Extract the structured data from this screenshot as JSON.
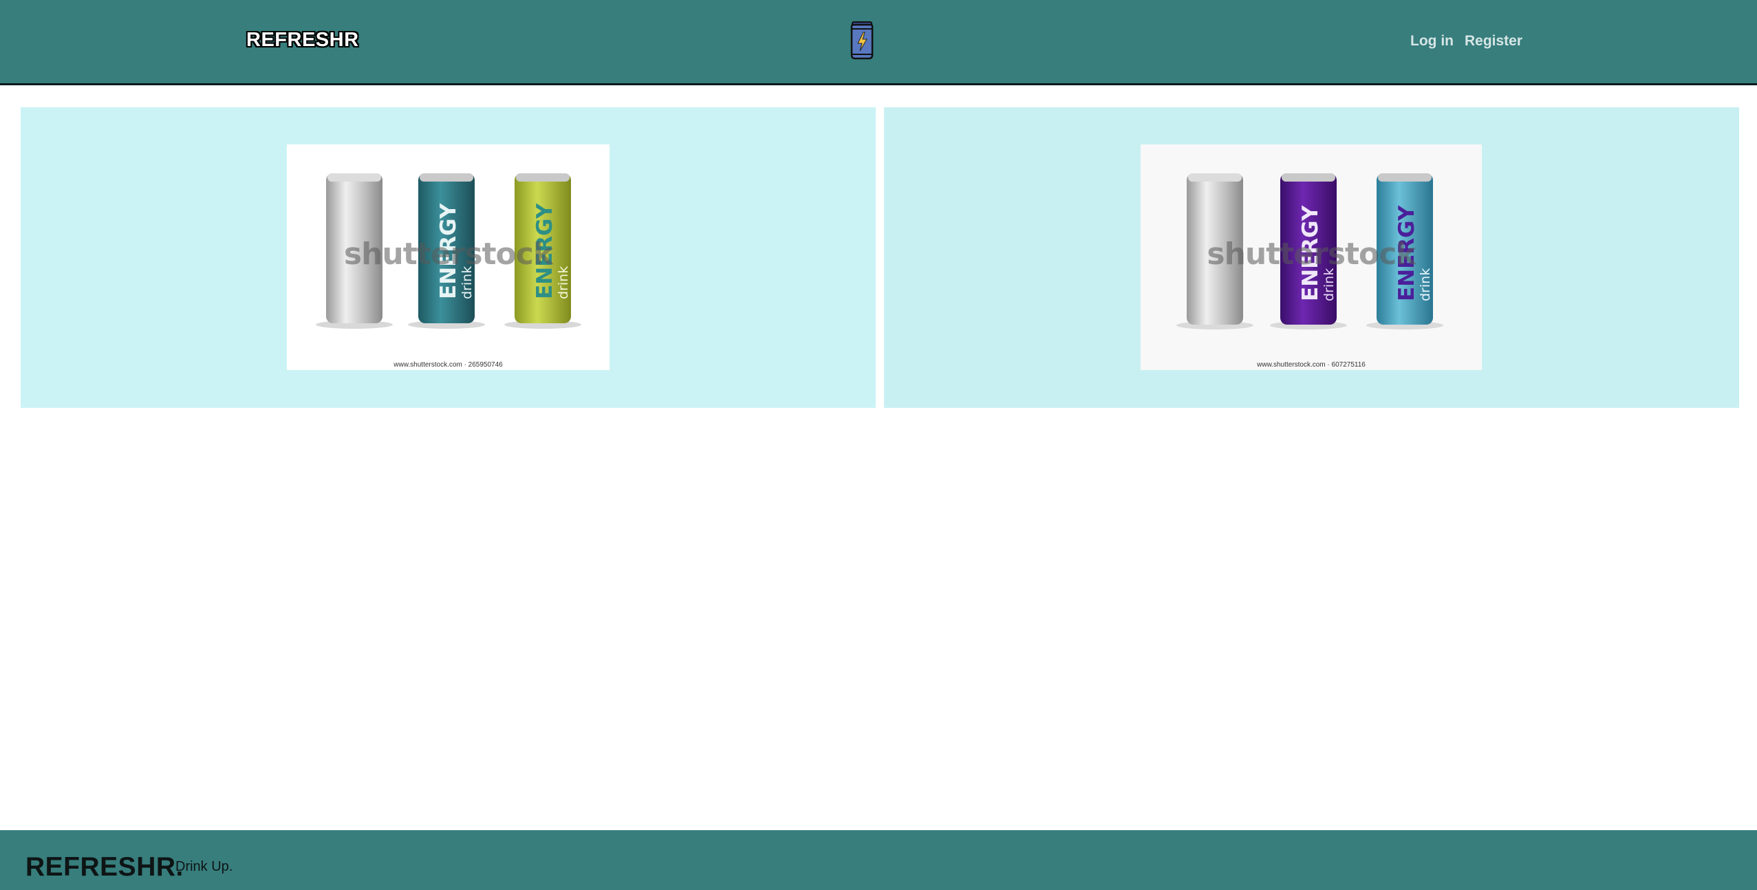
{
  "header": {
    "brand": "REFRESHR",
    "logo_icon": "energy-can-icon",
    "nav": {
      "login": "Log in",
      "register": "Register"
    }
  },
  "products": [
    {
      "watermark": "shutterstock",
      "credit": "www.shutterstock.com · 265950746",
      "can_text": "ENERGY",
      "can_subtext": "drink",
      "colors": [
        "#c7c7c7",
        "#2e7d88",
        "#b9c93a"
      ]
    },
    {
      "watermark": "shutterstock",
      "credit": "www.shutterstock.com · 607275116",
      "can_text": "ENERGY",
      "can_subtext": "drink",
      "colors": [
        "#c7c7c7",
        "#5b1a98",
        "#4aa7c3"
      ]
    }
  ],
  "footer": {
    "brand": "REFRESHR.",
    "tagline": "Drink Up."
  },
  "theme": {
    "header_bg": "#377e7d",
    "card_bg": "#cbf3f5"
  }
}
